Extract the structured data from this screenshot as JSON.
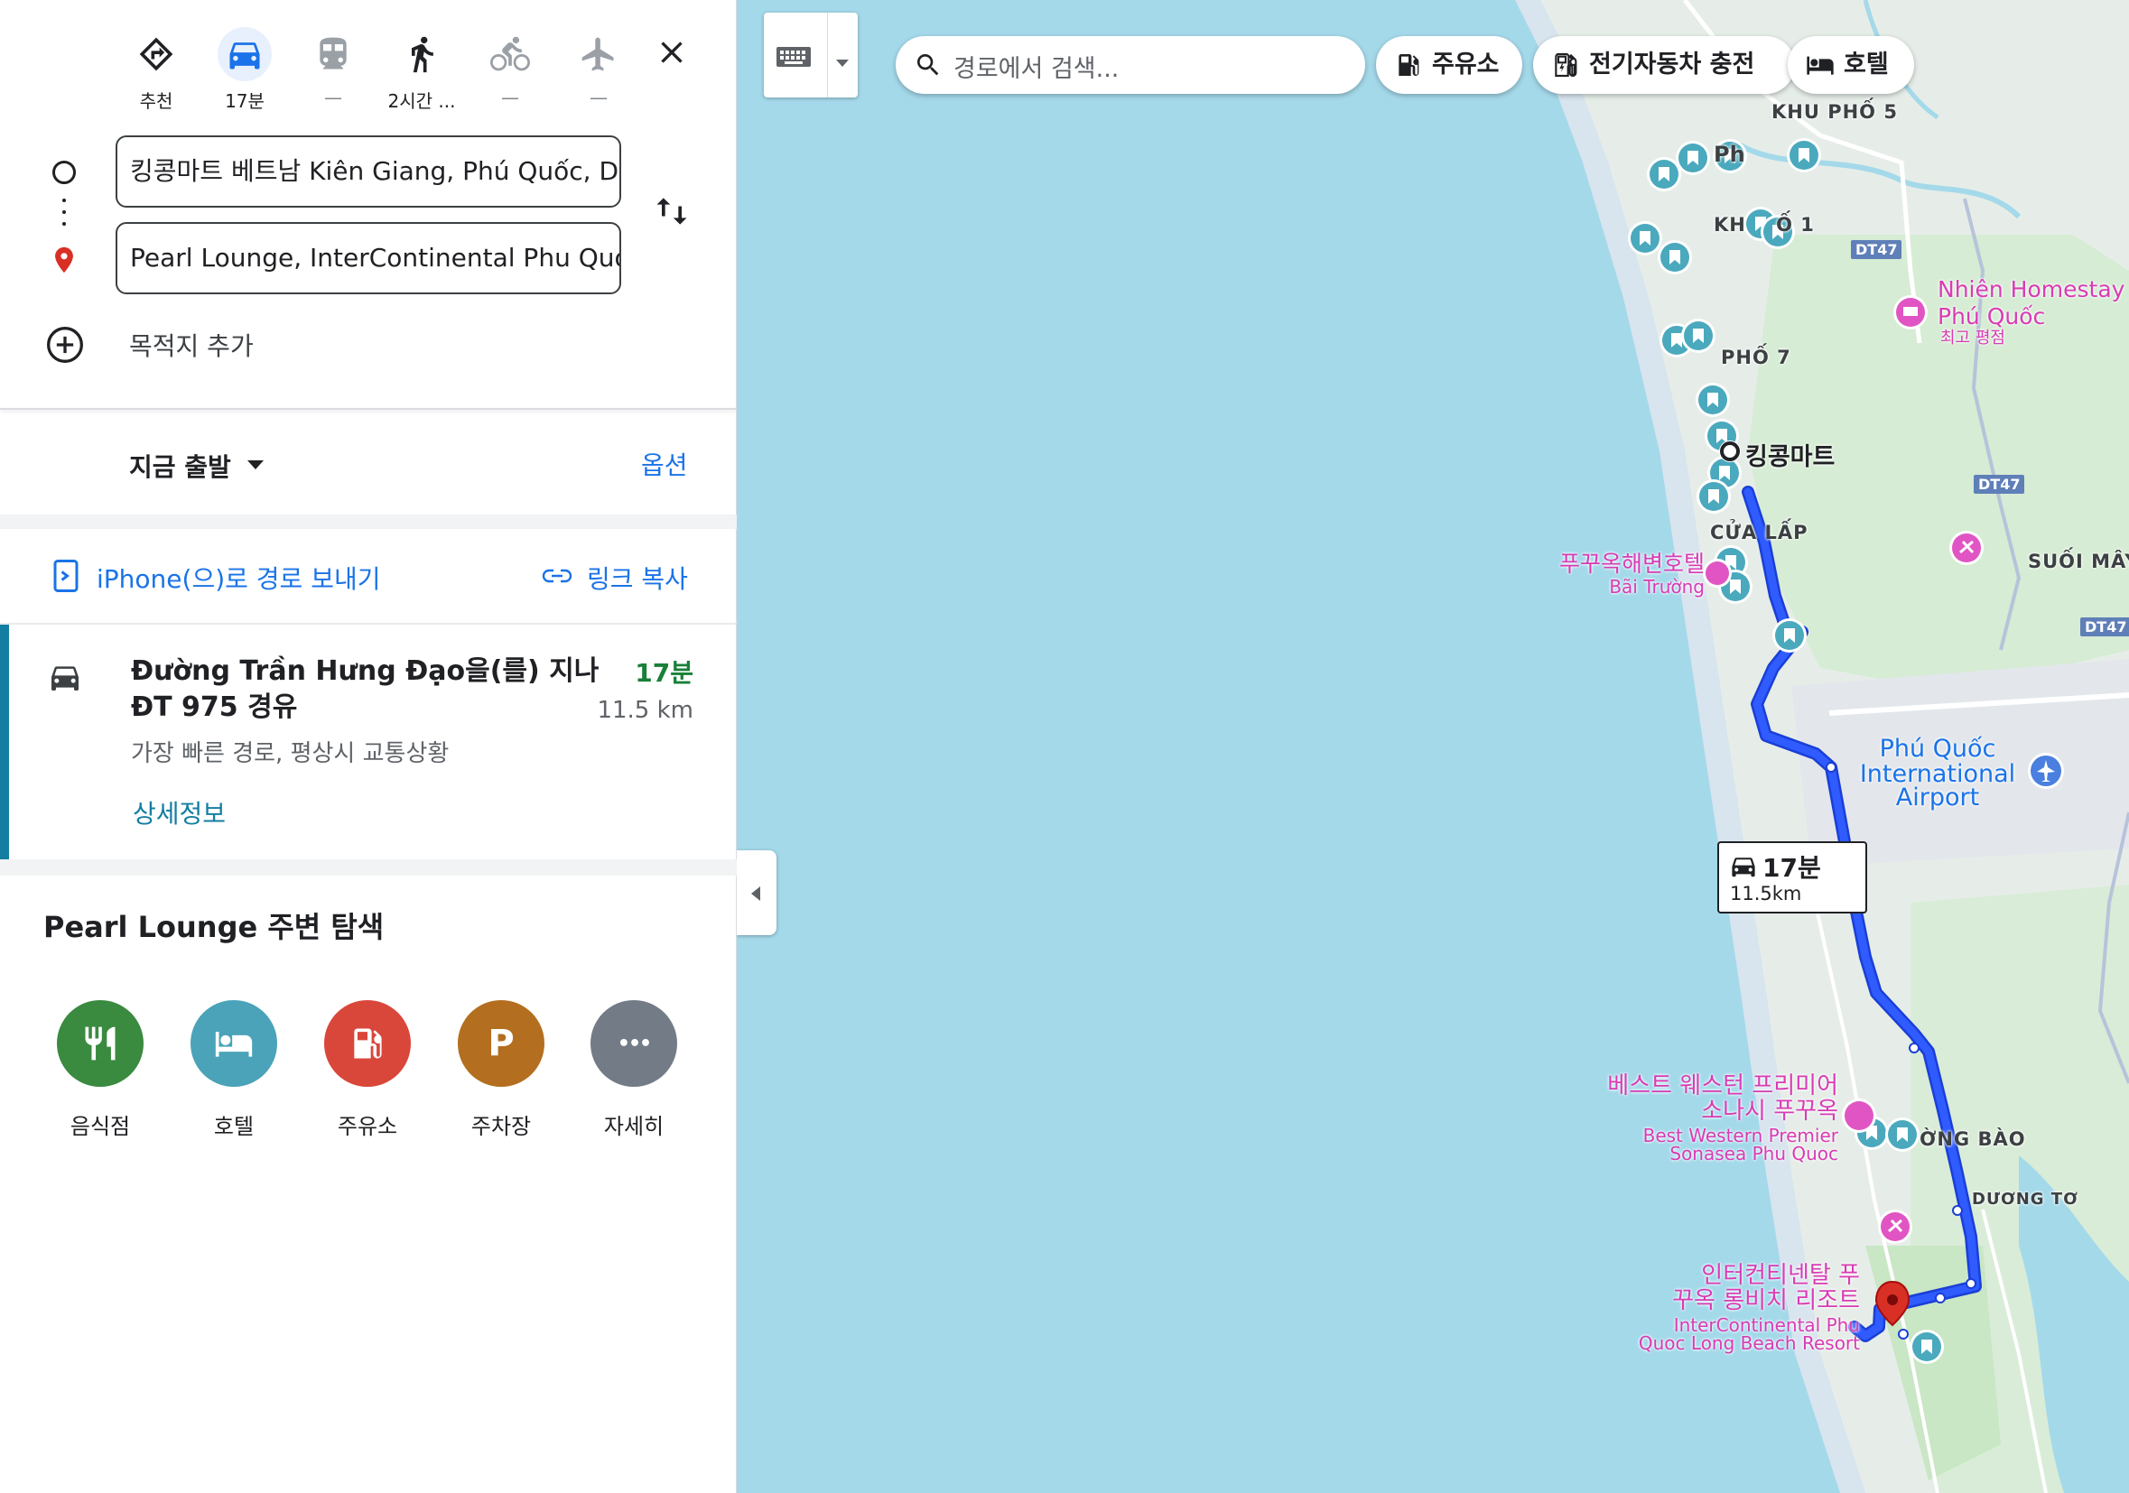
{
  "travel_modes": [
    {
      "name": "best",
      "label": "추천",
      "selected": false
    },
    {
      "name": "drive",
      "label": "17분",
      "selected": true
    },
    {
      "name": "transit",
      "label": "—",
      "selected": false
    },
    {
      "name": "walk",
      "label": "2시간 ...",
      "selected": false
    },
    {
      "name": "bike",
      "label": "—",
      "selected": false
    },
    {
      "name": "flight",
      "label": "—",
      "selected": false
    }
  ],
  "directions": {
    "origin": "킹콩마트 베트남 Kiên Giang, Phú Quốc, Dương Đông",
    "destination": "Pearl Lounge, InterContinental Phu Quoc Long Beach Resort",
    "add_destination": "목적지 추가"
  },
  "departure": {
    "label": "지금 출발",
    "options_label": "옵션"
  },
  "share": {
    "send_to_phone": "iPhone(으)로 경로 보내기",
    "copy_link": "링크 복사"
  },
  "route": {
    "title": "Đường Trần Hưng Đạo을(를) 지나 ĐT 975 경유",
    "time": "17분",
    "distance": "11.5 km",
    "summary": "가장 빠른 경로, 평상시 교통상황",
    "details_label": "상세정보"
  },
  "nearby": {
    "title": "Pearl Lounge 주변 탐색",
    "categories": [
      {
        "label": "음식점",
        "color": "#3a8a3f",
        "icon": "restaurant-icon"
      },
      {
        "label": "호텔",
        "color": "#4aa3b8",
        "icon": "hotel-icon"
      },
      {
        "label": "주유소",
        "color": "#d9473b",
        "icon": "gas-icon"
      },
      {
        "label": "주차장",
        "color": "#b36f1f",
        "icon": "parking-icon",
        "glyph": "P"
      },
      {
        "label": "자세히",
        "color": "#737c86",
        "icon": "more-icon",
        "glyph": "•••"
      }
    ]
  },
  "map": {
    "search_placeholder": "경로에서 검색...",
    "chips": [
      "주유소",
      "전기자동차 충전",
      "호텔"
    ],
    "route_badge": {
      "time": "17분",
      "distance": "11.5km"
    },
    "labels": {
      "khu_pho_5": "KHU PHỐ 5",
      "khu_pho_1": "KH    Ố 1",
      "pho_7": "PHỐ 7",
      "cua_lap": "CỬA LẤP",
      "suoi_may": "SUỐI MÂY",
      "duong_bao": "ỜNG BÀO",
      "duong_to": "DƯƠNG TƠ",
      "ph": "Ph",
      "kingkong": "킹콩마트",
      "homestay_1": "Nhiên Homestay",
      "homestay_2": "Phú Quốc",
      "homestay_3": "최고 평점",
      "hotel_kr": "푸꾸옥해변호텔",
      "hotel_vn": "Bãi Trường",
      "airport_1": "Phú Quốc",
      "airport_2": "International",
      "airport_3": "Airport",
      "bw_kr1": "베스트 웨스턴 프리미어",
      "bw_kr2": "소나시 푸꾸옥",
      "bw_en1": "Best Western Premier",
      "bw_en2": "Sonasea Phu Quoc",
      "ic_kr1": "인터컨티넨탈 푸",
      "ic_kr2": "꾸옥 롱비치 리조트",
      "ic_en1": "InterContinental Phu",
      "ic_en2": "Quoc Long Beach Resort",
      "dt47": "DT47"
    }
  }
}
